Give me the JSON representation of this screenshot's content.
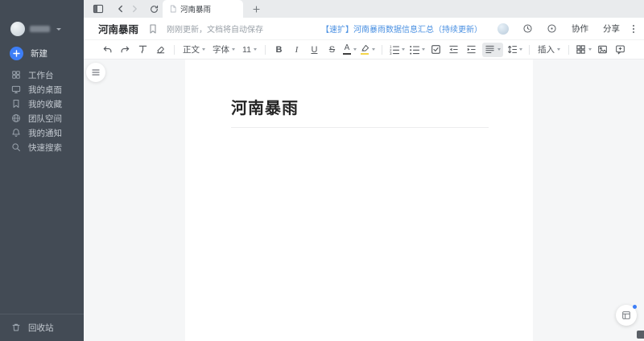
{
  "colors": {
    "sidebar_bg": "#434b55",
    "accent_blue": "#3d7ef7",
    "link_blue": "#4a90e2",
    "tabbar_bg": "#e9ebed",
    "doc_bg": "#f5f6f7",
    "font_color_bar": "#3f3f3f",
    "highlight_yellow": "#f5d548"
  },
  "icons": {
    "sidebar": [
      "workbench-icon",
      "desktop-icon",
      "favorites-icon",
      "team-space-icon",
      "bell-icon",
      "search-icon",
      "trash-icon",
      "plus-icon"
    ],
    "tabbar": [
      "sidebar-toggle-icon",
      "chevron-left-icon",
      "chevron-right-icon",
      "refresh-icon",
      "document-icon",
      "plus-icon"
    ],
    "header": [
      "bookmark-icon",
      "history-icon",
      "presentation-mode-icon",
      "more-vertical-icon"
    ],
    "toolbar": [
      "undo-icon",
      "redo-icon",
      "format-painter-icon",
      "clear-format-icon",
      "highlighter-icon",
      "ordered-list-icon",
      "bullet-list-icon",
      "checklist-icon",
      "outdent-icon",
      "indent-icon",
      "align-icon",
      "line-spacing-icon",
      "table-icon",
      "image-icon",
      "comment-icon"
    ],
    "doc": [
      "outline-toggle-icon",
      "templates-icon"
    ]
  },
  "sidebar": {
    "new_label": "新建",
    "items": [
      {
        "label": "工作台"
      },
      {
        "label": "我的桌面"
      },
      {
        "label": "我的收藏"
      },
      {
        "label": "团队空间"
      },
      {
        "label": "我的通知"
      },
      {
        "label": "快速搜索"
      }
    ],
    "trash_label": "回收站"
  },
  "tabbar": {
    "active_tab_title": "河南暴雨"
  },
  "header": {
    "title": "河南暴雨",
    "status": "刚刚更新，文档将自动保存",
    "related_link": "【速扩】河南暴雨数据信息汇总（持续更新）",
    "collaborate_label": "协作",
    "share_label": "分享"
  },
  "toolbar": {
    "paragraph_style": "正文",
    "font_name": "字体",
    "font_size": "11",
    "bold": "B",
    "italic": "I",
    "underline": "U",
    "strikethrough": "S",
    "font_color_letter": "A",
    "insert_label": "插入"
  },
  "doc": {
    "title": "河南暴雨"
  }
}
